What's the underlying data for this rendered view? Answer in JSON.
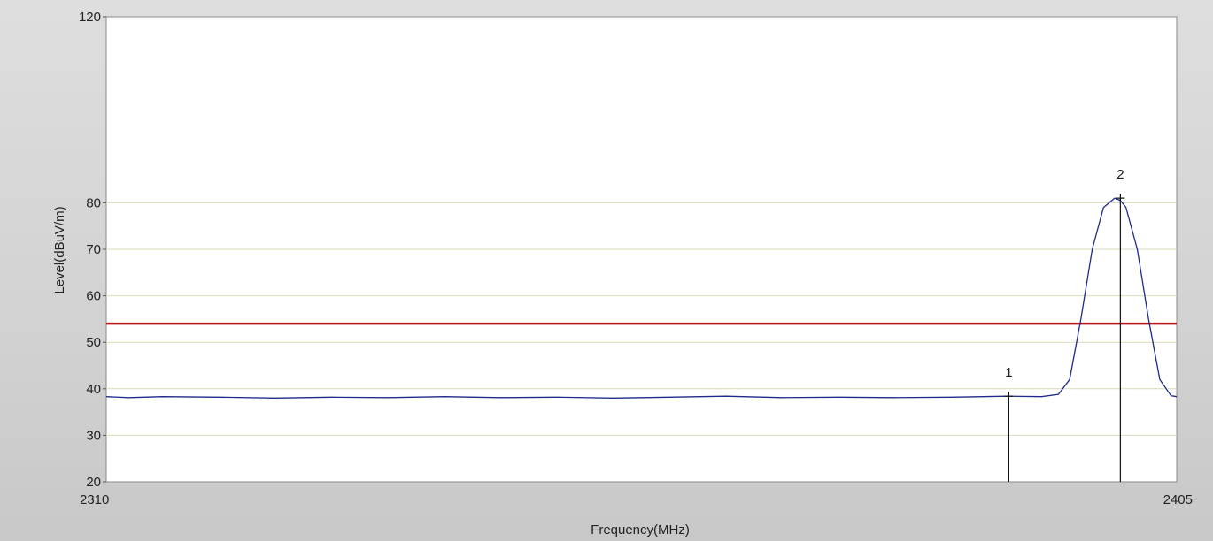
{
  "chart_data": {
    "type": "line",
    "title": "",
    "xlabel": "Frequency(MHz)",
    "ylabel": "Level(dBuV/m)",
    "xlim": [
      2310,
      2405
    ],
    "ylim": [
      20,
      120
    ],
    "x_tick_labels": [
      "2310",
      "2405"
    ],
    "y_tick_labels": [
      "20",
      "30",
      "40",
      "50",
      "60",
      "70",
      "80",
      "120"
    ],
    "grid": true,
    "limit_line": {
      "value": 54,
      "color": "#c0141c"
    },
    "series": [
      {
        "color": "#1f2a8a",
        "x": [
          2310,
          2312,
          2315,
          2320,
          2325,
          2330,
          2335,
          2340,
          2345,
          2350,
          2355,
          2360,
          2365,
          2370,
          2375,
          2380,
          2385,
          2390,
          2393,
          2394.5,
          2395.5,
          2396.5,
          2397.5,
          2398.5,
          2399.5,
          2400,
          2400.5,
          2401.5,
          2402.5,
          2403.5,
          2404.5,
          2405
        ],
        "y": [
          38.3,
          38.1,
          38.3,
          38.2,
          38.0,
          38.2,
          38.1,
          38.3,
          38.1,
          38.2,
          38.0,
          38.2,
          38.4,
          38.1,
          38.2,
          38.1,
          38.2,
          38.4,
          38.3,
          38.8,
          42,
          55,
          70,
          79,
          81,
          80.5,
          79,
          70,
          55,
          42,
          38.5,
          38.3
        ]
      }
    ],
    "markers": [
      {
        "label": "1",
        "x": 2390.1,
        "y": 38.4
      },
      {
        "label": "2",
        "x": 2400,
        "y": 81.0
      }
    ]
  }
}
